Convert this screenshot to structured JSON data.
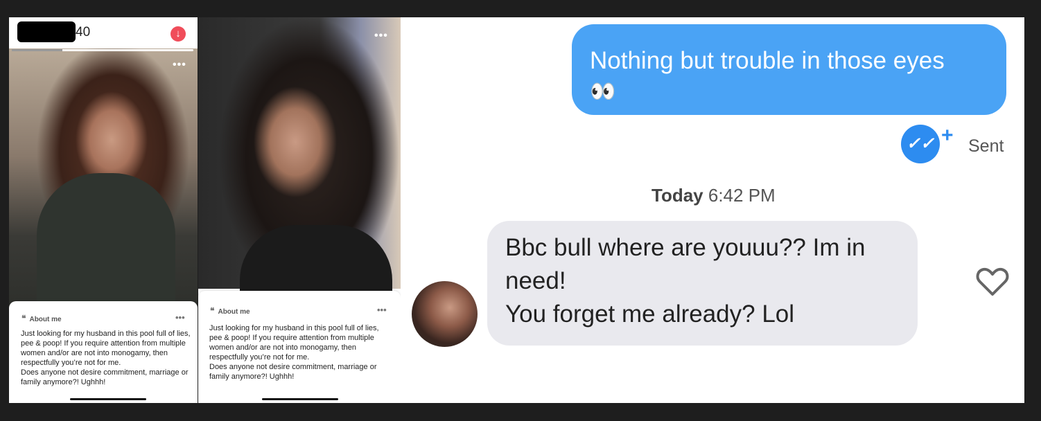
{
  "profile1": {
    "age": "40",
    "about_title": "About me",
    "about_text": [
      "Just looking for my husband in this pool full of lies, pee & poop! If you require attention from multiple women and/or are not into monogamy, then respectfully you’re not for me.",
      "Does anyone not desire commitment, marriage or family anymore?! Ughhh!"
    ],
    "photo_progress": 0.28,
    "icons": [
      "download-icon",
      "more-dots-icon",
      "quote-icon"
    ]
  },
  "profile2": {
    "about_title": "About me",
    "about_text": [
      "Just looking for my husband in this pool full of lies, pee & poop! If you require attention from multiple women and/or are not into monogamy, then respectfully you’re not for me.",
      "Does anyone not desire commitment, marriage or family anymore?! Ughhh!"
    ],
    "icons": [
      "more-dots-icon",
      "quote-icon"
    ]
  },
  "chat": {
    "sent_message": "Nothing but trouble in those eyes",
    "sent_emoji": "👀",
    "sent_status": "Sent",
    "timestamp_day": "Today",
    "timestamp_time": "6:42 PM",
    "received_message_lines": [
      "Bbc bull where are youuu?? Im in",
      "need!",
      "You forget me already? Lol"
    ],
    "colors": {
      "sent_bubble": "#4aa3f5",
      "received_bubble": "#e9e9ee",
      "check": "#2d8cf0"
    },
    "icons": [
      "double-check-icon",
      "plus-icon",
      "heart-icon"
    ]
  }
}
